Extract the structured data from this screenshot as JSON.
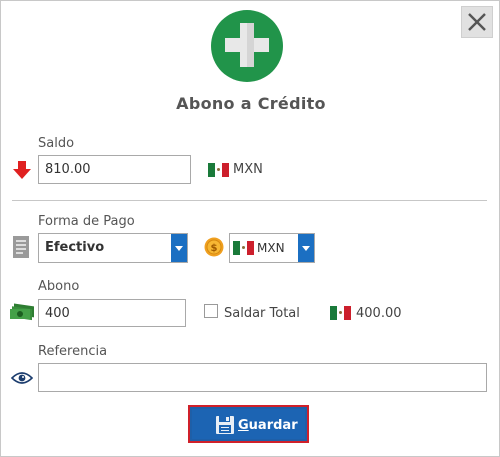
{
  "dialog": {
    "title": "Abono a Crédito"
  },
  "saldo": {
    "label": "Saldo",
    "value": "810.00",
    "currency": "MXN"
  },
  "forma_pago": {
    "label": "Forma de Pago",
    "selected": "Efectivo",
    "currency_selected": "MXN"
  },
  "abono": {
    "label": "Abono",
    "value": "400",
    "saldar_label": "Saldar Total",
    "saldar_checked": false,
    "total": "400.00"
  },
  "referencia": {
    "label": "Referencia",
    "value": ""
  },
  "actions": {
    "save_first_letter": "G",
    "save_rest": "uardar"
  },
  "icons": {
    "close": "close-icon",
    "hero": "plus-icon",
    "saldo": "arrow-down-icon",
    "forma": "document-icon",
    "currency": "coin-icon",
    "abono": "money-icon",
    "referencia": "eye-icon",
    "save": "floppy-disk-icon",
    "flag": "mexico-flag-icon"
  },
  "colors": {
    "accent_blue": "#1c64b3",
    "hero_green": "#21944a",
    "arrow_red": "#e02020",
    "save_border": "#d0202a"
  }
}
